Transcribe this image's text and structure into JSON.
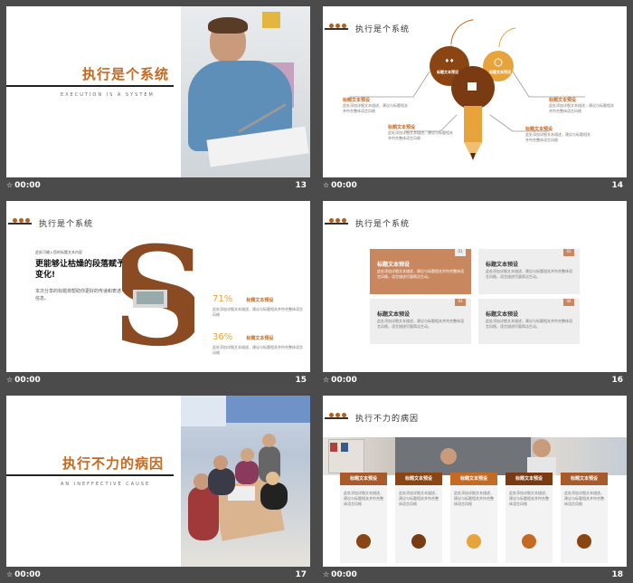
{
  "slides": [
    {
      "time": "00:00",
      "number": "13",
      "title": "执行是个系统",
      "subtitle": "EXECUTION IS A SYSTEM"
    },
    {
      "time": "00:00",
      "number": "14",
      "header": "执行是个系统",
      "circle_labels": [
        "标题文本预设",
        "标题文本预设"
      ],
      "callouts": [
        {
          "title": "标题文本预设",
          "body": "此处添加详细文本描述，建议与标题相关并符合整体语言风格"
        },
        {
          "title": "标题文本预设",
          "body": "此处添加详细文本描述，建议与标题相关并符合整体语言风格"
        },
        {
          "title": "标题文本预设",
          "body": "此处添加详细文本描述，建议与标题相关并符合整体语言风格"
        },
        {
          "title": "标题文本预设",
          "body": "此处添加详细文本描述，建议与标题相关并符合整体语言风格"
        }
      ]
    },
    {
      "time": "00:00",
      "number": "15",
      "header": "执行是个系统",
      "small_top": "此处可输入您的标题文本内容",
      "headline": "更能够让枯燥的段落赋予变化!",
      "desc": "本次分享的标题将帮助你更好的传递和表述信息。",
      "stats": [
        {
          "value": "71%",
          "label": "标题文本预设",
          "body": "此处添加详细文本描述，建议与标题相关并符合整体语言风格"
        },
        {
          "value": "36%",
          "label": "标题文本预设",
          "body": "此处添加详细文本描述，建议与标题相关并符合整体语言风格"
        }
      ]
    },
    {
      "time": "00:00",
      "number": "16",
      "header": "执行是个系统",
      "cards": [
        {
          "tag": "01",
          "title": "标题文本预设",
          "body": "此处添加详细文本描述，建议与标题相关并符合整体语言风格，语言描述尽量简洁生动。"
        },
        {
          "tag": "02",
          "title": "标题文本预设",
          "body": "此处添加详细文本描述，建议与标题相关并符合整体语言风格，语言描述尽量简洁生动。"
        },
        {
          "tag": "03",
          "title": "标题文本预设",
          "body": "此处添加详细文本描述，建议与标题相关并符合整体语言风格，语言描述尽量简洁生动。"
        },
        {
          "tag": "04",
          "title": "标题文本预设",
          "body": "此处添加详细文本描述，建议与标题相关并符合整体语言风格，语言描述尽量简洁生动。"
        }
      ]
    },
    {
      "time": "00:00",
      "number": "17",
      "title": "执行不力的病因",
      "subtitle": "AN INEFFECTIVE CAUSE"
    },
    {
      "time": "00:00",
      "number": "18",
      "header": "执行不力的病因",
      "columns": [
        {
          "title": "标题文本预设",
          "body": "此处添加详细文本描述，建议与标题相关并符合整体语言风格"
        },
        {
          "title": "标题文本预设",
          "body": "此处添加详细文本描述，建议与标题相关并符合整体语言风格"
        },
        {
          "title": "标题文本预设",
          "body": "此处添加详细文本描述，建议与标题相关并符合整体语言风格"
        },
        {
          "title": "标题文本预设",
          "body": "此处添加详细文本描述，建议与标题相关并符合整体语言风格"
        },
        {
          "title": "标题文本预设",
          "body": "此处添加详细文本描述，建议与标题相关并符合整体语言风格"
        }
      ]
    }
  ],
  "colors": {
    "accent": "#c46a22",
    "dark_brown": "#7a3a12",
    "gold": "#e7a33c",
    "bg": "#4b4b4b"
  }
}
